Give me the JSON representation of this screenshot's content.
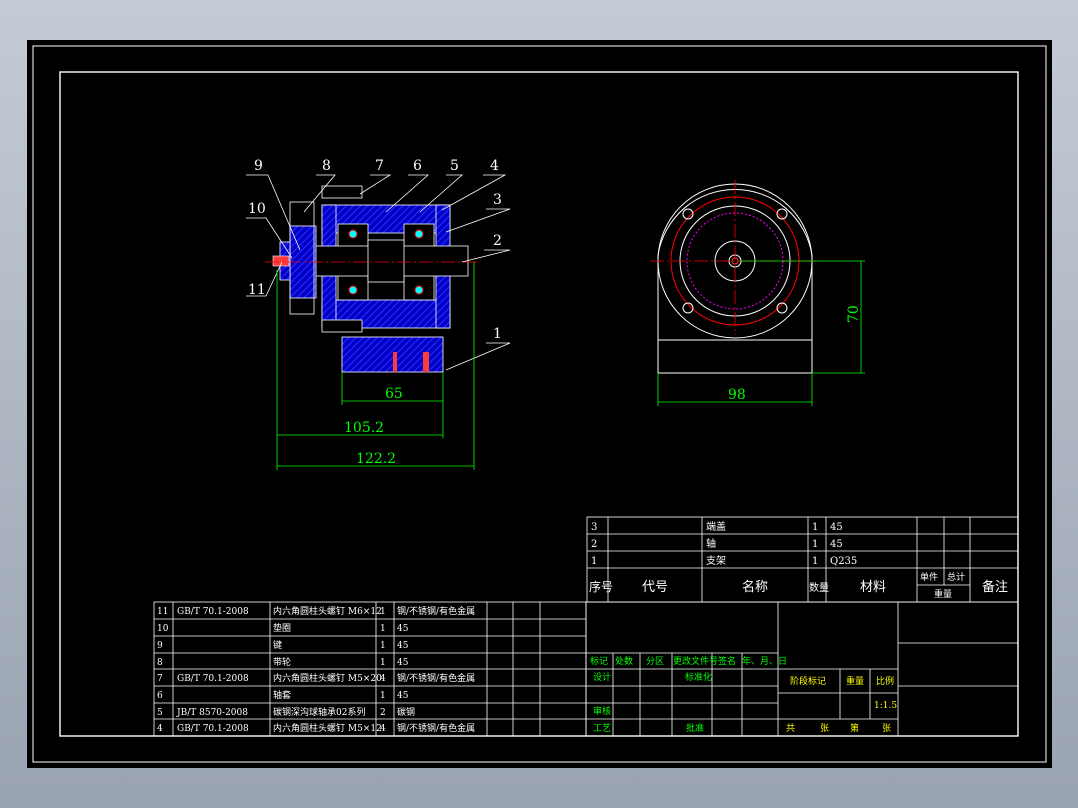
{
  "balloons": [
    {
      "num": "9"
    },
    {
      "num": "8"
    },
    {
      "num": "7"
    },
    {
      "num": "6"
    },
    {
      "num": "5"
    },
    {
      "num": "4"
    },
    {
      "num": "10"
    },
    {
      "num": "3"
    },
    {
      "num": "2"
    },
    {
      "num": "11"
    },
    {
      "num": "1"
    }
  ],
  "dimensions": {
    "d65": "65",
    "d105": "105.2",
    "d122": "122.2",
    "d98": "98",
    "d70": "70"
  },
  "upper_bom": [
    {
      "no": "3",
      "name": "端盖",
      "qty": "1",
      "material": "45"
    },
    {
      "no": "2",
      "name": "轴",
      "qty": "1",
      "material": "45"
    },
    {
      "no": "1",
      "name": "支架",
      "qty": "1",
      "material": "Q235"
    }
  ],
  "bom_header": {
    "no": "序号",
    "code": "代号",
    "name": "名称",
    "qty": "数量",
    "material": "材料",
    "unit_weight": "单件",
    "total_weight": "总计",
    "weight": "重量",
    "remark": "备注"
  },
  "lower_bom": [
    {
      "no": "11",
      "code": "GB/T 70.1-2008",
      "name": "内六角圆柱头螺钉 M6×12",
      "qty": "1",
      "material": "钢/不锈钢/有色金属"
    },
    {
      "no": "10",
      "code": "",
      "name": "垫圈",
      "qty": "1",
      "material": "45"
    },
    {
      "no": "9",
      "code": "",
      "name": "键",
      "qty": "1",
      "material": "45"
    },
    {
      "no": "8",
      "code": "",
      "name": "带轮",
      "qty": "1",
      "material": "45"
    },
    {
      "no": "7",
      "code": "GB/T 70.1-2008",
      "name": "内六角圆柱头螺钉 M5×20",
      "qty": "4",
      "material": "钢/不锈钢/有色金属"
    },
    {
      "no": "6",
      "code": "",
      "name": "轴套",
      "qty": "1",
      "material": "45"
    },
    {
      "no": "5",
      "code": "JB/T 8570-2008",
      "name": "碳钢深沟球轴承02系列",
      "qty": "2",
      "material": "碳钢"
    },
    {
      "no": "4",
      "code": "GB/T 70.1-2008",
      "name": "内六角圆柱头螺钉 M5×12",
      "qty": "4",
      "material": "钢/不锈钢/有色金属"
    }
  ],
  "title_block": {
    "mark": "标记",
    "count": "处数",
    "zone": "分区",
    "doc_no": "更改文件号",
    "sign": "签名",
    "date": "年、月、日",
    "design": "设计",
    "standard": "标准化",
    "check": "审核",
    "process": "工艺",
    "approve": "批准",
    "stage_mark": "阶段标记",
    "weight": "重量",
    "scale": "比例",
    "scale_value": "1:1.5",
    "total": "共",
    "sheets": "张",
    "page": "第",
    "page_unit": "张"
  },
  "colors": {
    "background": "#000000",
    "frame": "#ffffff",
    "dimension": "#00ff00",
    "centerline": "#ff0000",
    "hatch": "#0000ff",
    "text_yellow": "#ffff00",
    "pitch_circle": "#ff00ff"
  }
}
